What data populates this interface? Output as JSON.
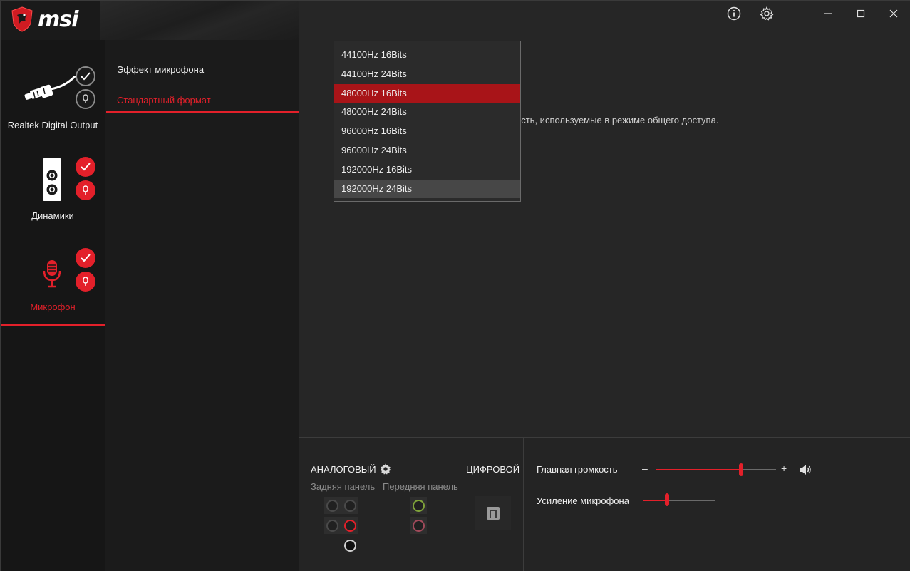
{
  "app": {
    "brand": "msi"
  },
  "devices": [
    {
      "label": "Realtek Digital Output",
      "icon": "digital-plug-icon"
    },
    {
      "label": "Динамики",
      "icon": "speaker-icon"
    },
    {
      "label": "Микрофон",
      "icon": "microphone-icon"
    }
  ],
  "submenu": {
    "items": [
      {
        "label": "Эффект микрофона"
      },
      {
        "label": "Стандартный формат"
      }
    ]
  },
  "main": {
    "description": "ость, используемые в режиме общего доступа."
  },
  "format_dropdown": {
    "options": [
      "44100Hz 16Bits",
      "44100Hz 24Bits",
      "48000Hz 16Bits",
      "48000Hz 24Bits",
      "96000Hz 16Bits",
      "96000Hz 24Bits",
      "192000Hz 16Bits",
      "192000Hz 24Bits"
    ],
    "selected": "48000Hz 16Bits",
    "hovered": "192000Hz 24Bits"
  },
  "connectors": {
    "analog_title": "АНАЛОГОВЫЙ",
    "digital_title": "ЦИФРОВОЙ",
    "rear_panel": "Задняя панель",
    "front_panel": "Передняя панель"
  },
  "volume": {
    "master_label": "Главная громкость",
    "master_minus": "–",
    "master_plus": "+",
    "master_level": 0.71,
    "mic_boost_label": "Усиление микрофона",
    "mic_boost_level": 0.34
  },
  "colors": {
    "accent": "#e3202a",
    "selected_option": "#a81418",
    "background": "#262626"
  }
}
